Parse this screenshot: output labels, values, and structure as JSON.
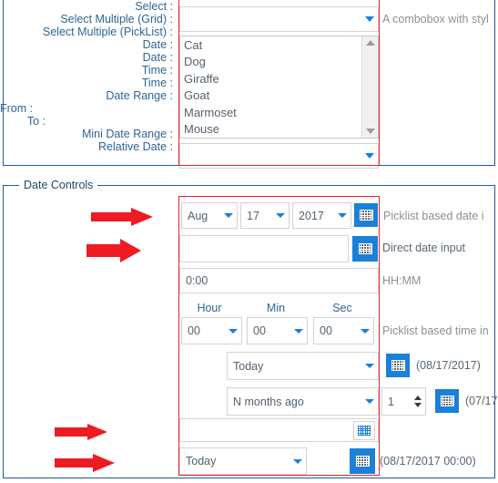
{
  "panels": {
    "top": {
      "name": "select-controls-panel"
    },
    "date": {
      "legend": "Date Controls"
    }
  },
  "select_section": {
    "select": {
      "label": "Select :",
      "value": "",
      "hint": "A combobox with styl"
    },
    "select_multiple_grid": {
      "label": "Select Multiple (Grid) :",
      "options": [
        "Cat",
        "Dog",
        "Giraffe",
        "Goat",
        "Marmoset",
        "Mouse"
      ]
    },
    "select_multiple_picklist": {
      "label": "Select Multiple (PickList) :",
      "value": ""
    }
  },
  "date_section": {
    "date_picklist": {
      "label": "Date :",
      "month": "Aug",
      "day": "17",
      "year": "2017",
      "hint": "Picklist based date i",
      "calendar_icon": "calendar-icon"
    },
    "date_direct": {
      "label": "Date :",
      "value": "",
      "hint": "Direct date input",
      "calendar_icon": "calendar-icon"
    },
    "time_text": {
      "label": "Time :",
      "value": "0:00",
      "hint": "HH:MM"
    },
    "time_picklist": {
      "label": "Time :",
      "headers": [
        "Hour",
        "Min",
        "Sec"
      ],
      "hour": "00",
      "min": "00",
      "sec": "00",
      "hint": "Picklist based time in"
    },
    "date_range": {
      "label": "Date Range :",
      "from_label": "From :",
      "from_value": "Today",
      "from_resolved": "(08/17/2017)",
      "to_label": "To :",
      "to_value": "N months ago",
      "to_count": "1",
      "to_resolved": "(07/17"
    },
    "mini_date_range": {
      "label": "Mini Date Range :",
      "value": ""
    },
    "relative_date": {
      "label": "Relative Date :",
      "value": "Today",
      "resolved": "(08/17/2017 00:00)"
    }
  },
  "annotations": {
    "arrow_color": "#ee1b22",
    "highlight_color": "#e8232a",
    "panel_border_color": "#1f5c99",
    "accent_color": "#1a80d9"
  }
}
